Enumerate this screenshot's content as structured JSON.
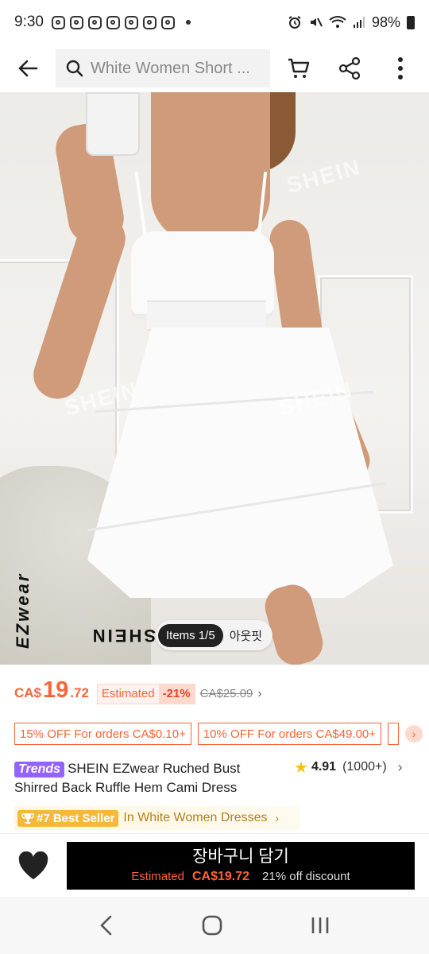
{
  "status_bar": {
    "time": "9:30",
    "battery": "98%",
    "icons": [
      "instagram-icon",
      "instagram-icon",
      "instagram-icon",
      "instagram-icon",
      "instagram-icon",
      "instagram-icon",
      "instagram-icon",
      "alarm-icon",
      "mute-icon",
      "wifi-icon",
      "signal-icon",
      "battery-icon"
    ]
  },
  "header": {
    "search_text": "White Women Short ...",
    "icons": [
      "back-arrow-icon",
      "search-icon",
      "cart-icon",
      "share-icon",
      "more-vertical-icon"
    ]
  },
  "hero": {
    "watermark": "SHEIN",
    "brand": "SHEIN",
    "brand_sub": "EZwear",
    "items_active": "Items 1/5",
    "items_alt": "아웃핏"
  },
  "price": {
    "currency": "CA$",
    "integer": "19",
    "decimal": ".72",
    "estimated_label": "Estimated",
    "discount_pct": "-21%",
    "original_price": "CA$25.09"
  },
  "coupons": [
    {
      "label": "15% OFF For orders CA$0.10+"
    },
    {
      "label": "10% OFF For orders CA$49.00+"
    }
  ],
  "product": {
    "trends_badge": "Trends",
    "title": "SHEIN EZwear Ruched Bust Shirred Back Ruffle Hem Cami Dress",
    "rating": "4.91",
    "rating_count": "(1000+)"
  },
  "best_seller": {
    "badge": "#7 Best Seller",
    "category": "In White Women Dresses"
  },
  "cart": {
    "label": "장바구니 담기",
    "estimated": "Estimated",
    "price": "CA$19.72",
    "discount": "21% off discount"
  },
  "colors": {
    "accent": "#fa6338",
    "trends": "#9462ff",
    "bestseller": "#f5b93a",
    "star": "#f9c314"
  }
}
